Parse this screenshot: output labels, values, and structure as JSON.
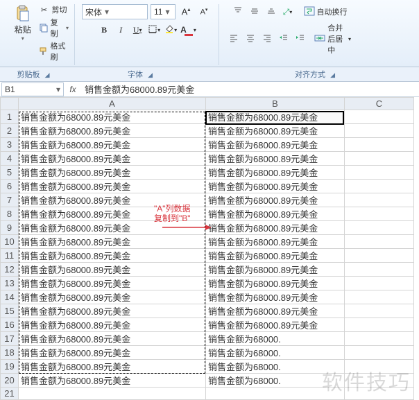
{
  "ribbon": {
    "clipboard": {
      "paste": "粘贴",
      "cut": "剪切",
      "copy": "复制",
      "format_painter": "格式刷",
      "group": "剪贴板"
    },
    "font": {
      "family": "宋体",
      "size": "11",
      "group": "字体"
    },
    "align": {
      "wrap": "自动换行",
      "merge": "合并后居中",
      "group": "对齐方式"
    }
  },
  "namebox": "B1",
  "formula": "销售金额为68000.89元美金",
  "columns": [
    "A",
    "B",
    "C"
  ],
  "rows": [
    {
      "n": 1,
      "A": "销售金额为68000.89元美金",
      "B": "销售金额为68000.89元美金"
    },
    {
      "n": 2,
      "A": "销售金额为68000.89元美金",
      "B": "销售金额为68000.89元美金"
    },
    {
      "n": 3,
      "A": "销售金额为68000.89元美金",
      "B": "销售金额为68000.89元美金"
    },
    {
      "n": 4,
      "A": "销售金额为68000.89元美金",
      "B": "销售金额为68000.89元美金"
    },
    {
      "n": 5,
      "A": "销售金额为68000.89元美金",
      "B": "销售金额为68000.89元美金"
    },
    {
      "n": 6,
      "A": "销售金额为68000.89元美金",
      "B": "销售金额为68000.89元美金"
    },
    {
      "n": 7,
      "A": "销售金额为68000.89元美金",
      "B": "销售金额为68000.89元美金"
    },
    {
      "n": 8,
      "A": "销售金额为68000.89元美金",
      "B": "销售金额为68000.89元美金"
    },
    {
      "n": 9,
      "A": "销售金额为68000.89元美金",
      "B": "销售金额为68000.89元美金"
    },
    {
      "n": 10,
      "A": "销售金额为68000.89元美金",
      "B": "销售金额为68000.89元美金"
    },
    {
      "n": 11,
      "A": "销售金额为68000.89元美金",
      "B": "销售金额为68000.89元美金"
    },
    {
      "n": 12,
      "A": "销售金额为68000.89元美金",
      "B": "销售金额为68000.89元美金"
    },
    {
      "n": 13,
      "A": "销售金额为68000.89元美金",
      "B": "销售金额为68000.89元美金"
    },
    {
      "n": 14,
      "A": "销售金额为68000.89元美金",
      "B": "销售金额为68000.89元美金"
    },
    {
      "n": 15,
      "A": "销售金额为68000.89元美金",
      "B": "销售金额为68000.89元美金"
    },
    {
      "n": 16,
      "A": "销售金额为68000.89元美金",
      "B": "销售金额为68000.89元美金"
    },
    {
      "n": 17,
      "A": "销售金额为68000.89元美金",
      "B": "销售金额为68000."
    },
    {
      "n": 18,
      "A": "销售金额为68000.89元美金",
      "B": "销售金额为68000."
    },
    {
      "n": 19,
      "A": "销售金额为68000.89元美金",
      "B": "销售金额为68000."
    },
    {
      "n": 20,
      "A": "销售金额为68000.89元美金",
      "B": "销售金额为68000."
    },
    {
      "n": 21,
      "A": "",
      "B": ""
    }
  ],
  "annotation": {
    "line1": "\"A\"列数据",
    "line2": "复制到\"B\""
  },
  "watermark": "软件技巧"
}
